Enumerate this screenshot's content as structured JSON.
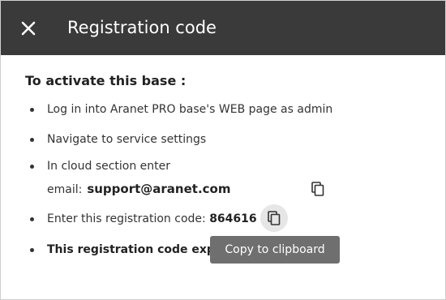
{
  "dialog": {
    "title": "Registration code",
    "close_icon": "close-icon"
  },
  "instructions": {
    "heading": "To activate this base :",
    "step1": "Log in into Aranet PRO base's WEB page as admin",
    "step2": "Navigate to service settings",
    "step3": "In cloud section enter",
    "email_label": "email:",
    "email_value": "support@aranet.com",
    "step4_label": "Enter this registration code:",
    "code_value": "864616",
    "step5": "This registration code expires"
  },
  "tooltip": {
    "text": "Copy to clipboard"
  },
  "icons": {
    "copy": "copy-icon"
  },
  "colors": {
    "header_bg": "#3a3a3a",
    "tooltip_bg": "#6f6f6f",
    "text": "#333333"
  }
}
